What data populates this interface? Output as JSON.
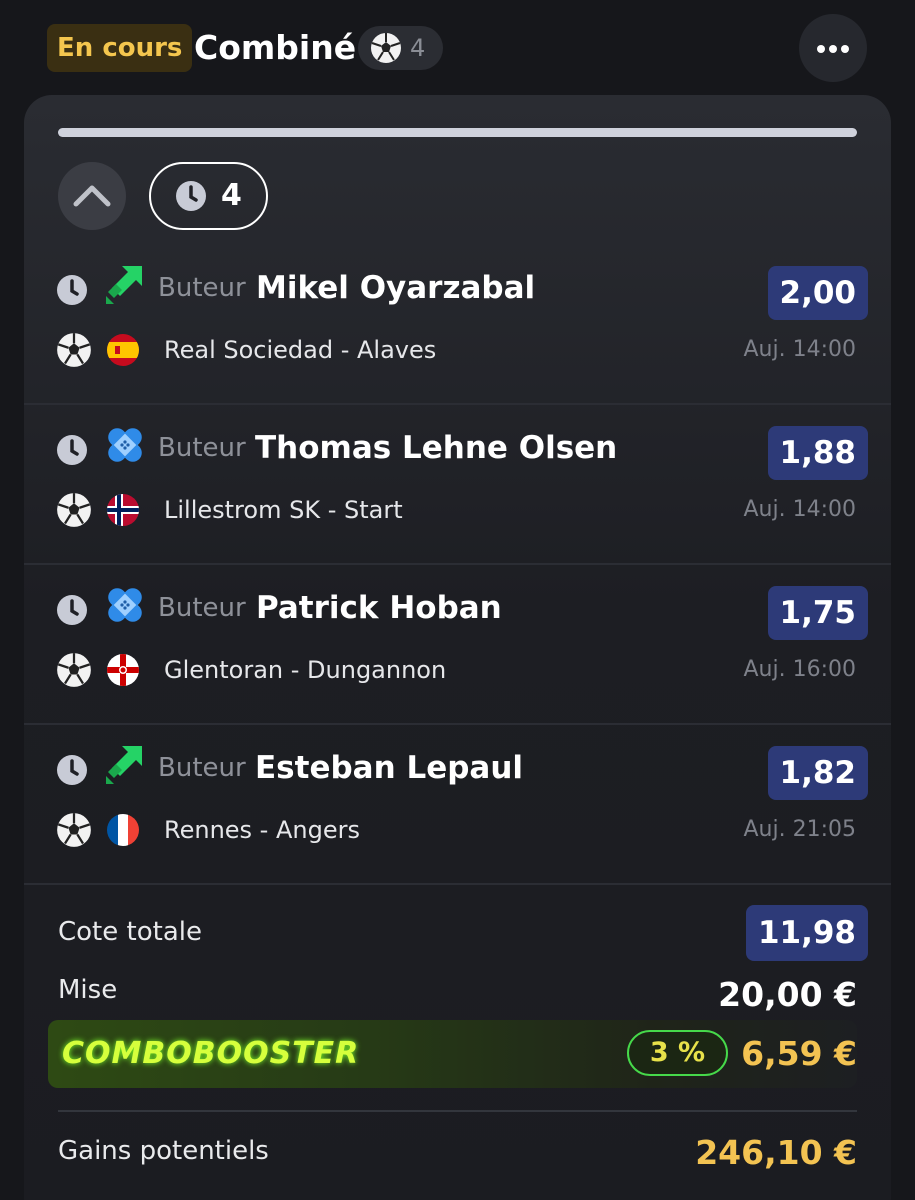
{
  "header": {
    "status": "En cours",
    "bet_type": "Combiné",
    "sport_icon": "soccer-ball-icon",
    "selection_count": "4",
    "more_icon": "ellipsis-icon"
  },
  "progress": {
    "settled_fraction": 0
  },
  "controls": {
    "collapse_icon": "chevron-up-icon",
    "pending_icon": "clock-icon",
    "pending_count": "4"
  },
  "selections": [
    {
      "status_icon": "clock-icon",
      "badge_icon": "boost-arrows-icon",
      "badge_color": "#25d366",
      "market": "Buteur",
      "player": "Mikel Oyarzabal",
      "odd": "2,00",
      "sport_icon": "soccer-ball-icon",
      "flag": "spain-flag-icon",
      "match": "Real Sociedad - Alaves",
      "kickoff": "Auj. 14:00"
    },
    {
      "status_icon": "clock-icon",
      "badge_icon": "shield-bandage-icon",
      "badge_color": "#2f8be8",
      "market": "Buteur",
      "player": "Thomas Lehne Olsen",
      "odd": "1,88",
      "sport_icon": "soccer-ball-icon",
      "flag": "norway-flag-icon",
      "match": "Lillestrom SK - Start",
      "kickoff": "Auj. 14:00"
    },
    {
      "status_icon": "clock-icon",
      "badge_icon": "shield-bandage-icon",
      "badge_color": "#2f8be8",
      "market": "Buteur",
      "player": "Patrick Hoban",
      "odd": "1,75",
      "sport_icon": "soccer-ball-icon",
      "flag": "northern-ireland-flag-icon",
      "match": "Glentoran - Dungannon",
      "kickoff": "Auj. 16:00"
    },
    {
      "status_icon": "clock-icon",
      "badge_icon": "boost-arrows-icon",
      "badge_color": "#25d366",
      "market": "Buteur",
      "player": "Esteban Lepaul",
      "odd": "1,82",
      "sport_icon": "soccer-ball-icon",
      "flag": "france-flag-icon",
      "match": "Rennes - Angers",
      "kickoff": "Auj. 21:05"
    }
  ],
  "summary": {
    "total_odds_label": "Cote totale",
    "total_odds": "11,98",
    "stake_label": "Mise",
    "stake": "20,00 €",
    "booster_logo": "COMBOBOOSTER",
    "booster_percent": "3 %",
    "booster_amount": "6,59 €",
    "gains_label": "Gains potentiels",
    "gains": "246,10 €"
  },
  "colors": {
    "background": "#16171b",
    "status_badge": "#f4c64e",
    "odds_badge": "#2d3a78",
    "gains": "#f3c352"
  }
}
